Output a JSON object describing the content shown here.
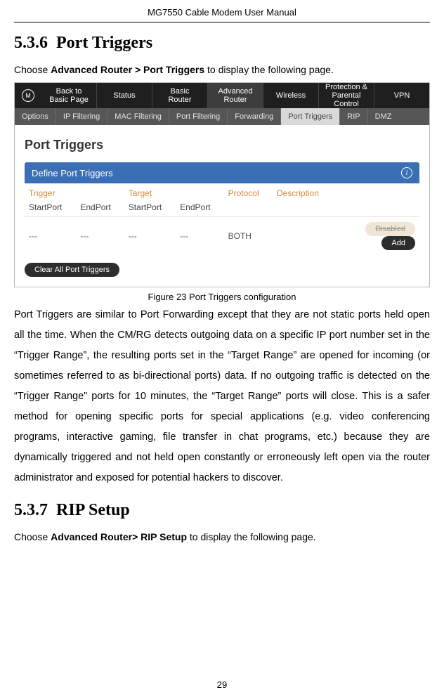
{
  "doc": {
    "header_title": "MG7550 Cable Modem User Manual",
    "page_number": "29"
  },
  "section1": {
    "number": "5.3.6",
    "title": "Port Triggers",
    "intro_prefix": "Choose ",
    "intro_bold": "Advanced Router > Port Triggers",
    "intro_suffix": " to display the following page.",
    "figure_caption": "Figure 23 Port Triggers configuration",
    "body": "Port Triggers are similar to Port Forwarding except that they are not static ports held open all the time.  When the CM/RG detects outgoing data on a specific IP port number set in the “Trigger Range”, the resulting ports set in the “Target Range” are opened for incoming (or sometimes referred to as bi-directional ports) data.  If no outgoing traffic is detected on the “Trigger Range” ports for 10 minutes, the “Target Range” ports will close.    This is a safer method for opening specific ports for special applications (e.g. video conferencing programs, interactive gaming, file transfer in chat programs, etc.) because they are dynamically triggered and not held open constantly or erroneously left open via the router administrator and exposed for potential hackers to discover."
  },
  "section2": {
    "number": "5.3.7",
    "title": "RIP Setup",
    "intro_prefix": "Choose ",
    "intro_bold": "Advanced Router> RIP Setup",
    "intro_suffix": " to display the following page."
  },
  "screenshot": {
    "nav1": {
      "back": "Back to\nBasic Page",
      "status": "Status",
      "basic_router": "Basic\nRouter",
      "adv_router": "Advanced\nRouter",
      "wireless": "Wireless",
      "protection": "Protection &\nParental Control",
      "vpn": "VPN"
    },
    "nav2": {
      "options": "Options",
      "ip_filtering": "IP Filtering",
      "mac_filtering": "MAC Filtering",
      "port_filtering": "Port Filtering",
      "forwarding": "Forwarding",
      "port_triggers": "Port Triggers",
      "rip": "RIP",
      "dmz": "DMZ"
    },
    "page_title": "Port Triggers",
    "panel": {
      "header": "Define Port Triggers",
      "cols": {
        "trigger": "Trigger",
        "target": "Target",
        "protocol": "Protocol",
        "description": "Description",
        "start": "StartPort",
        "end": "EndPort"
      },
      "row": {
        "t_start": "---",
        "t_end": "---",
        "g_start": "---",
        "g_end": "---",
        "protocol": "BOTH",
        "description": ""
      },
      "disabled_label": "Disabled",
      "add_label": "Add",
      "clear_label": "Clear All Port Triggers"
    }
  }
}
